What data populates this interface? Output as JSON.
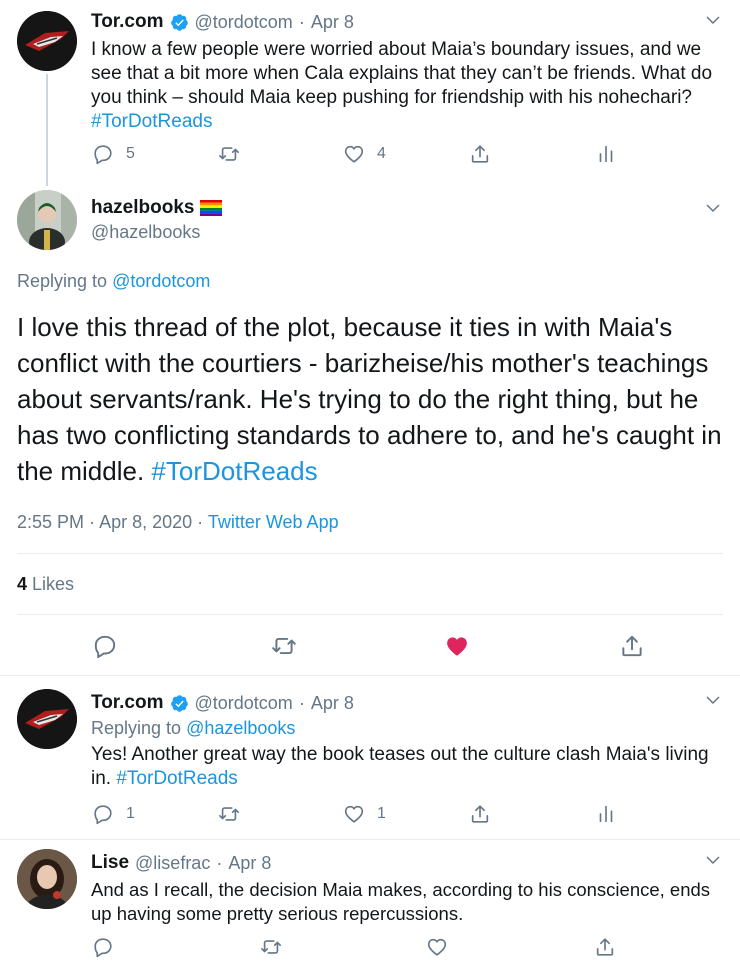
{
  "tweet1": {
    "name": "Tor.com",
    "handle": "@tordotcom",
    "sep": "·",
    "date": "Apr 8",
    "text": "I know a few people were worried about Maia’s boundary issues, and we see that a bit more when Cala explains that they can’t be friends. What do you think – should Maia keep pushing for friendship with his nohechari?",
    "hashtag": "#TorDotReads",
    "replies": "5",
    "likes": "4"
  },
  "main": {
    "name": "hazelbooks",
    "handle": "@hazelbooks",
    "replying_prefix": "Replying to",
    "replying_to": "@tordotcom",
    "text": "I love this thread of the plot, because it ties in with Maia's conflict with the courtiers - barizheise/his mother's teachings about servants/rank. He's trying to do the right thing, but he has two conflicting standards to adhere to, and he's caught in the middle.",
    "hashtag": "#TorDotReads",
    "time": "2:55 PM",
    "dot1": "·",
    "date": "Apr 8, 2020",
    "dot2": "·",
    "source": "Twitter Web App",
    "likes_count": "4",
    "likes_label": "Likes"
  },
  "tweet3": {
    "name": "Tor.com",
    "handle": "@tordotcom",
    "sep": "·",
    "date": "Apr 8",
    "replying_prefix": "Replying to",
    "replying_to": "@hazelbooks",
    "text": "Yes! Another great way the book teases out the culture clash Maia's living in.",
    "hashtag": "#TorDotReads",
    "replies": "1",
    "likes": "1"
  },
  "tweet4": {
    "name": "Lise",
    "handle": "@lisefrac",
    "sep": "·",
    "date": "Apr 8",
    "text": "And as I recall, the decision Maia makes, according to his conscience, ends up having some pretty serious repercussions."
  },
  "colors": {
    "link": "#1b95e0",
    "muted": "#657786",
    "heart": "#e0245e",
    "divider": "#e6ecf0"
  },
  "icons": [
    "reply-icon",
    "retweet-icon",
    "like-icon",
    "share-icon",
    "analytics-icon",
    "verified-badge-icon",
    "chevron-down-icon",
    "rainbow-flag-icon"
  ]
}
